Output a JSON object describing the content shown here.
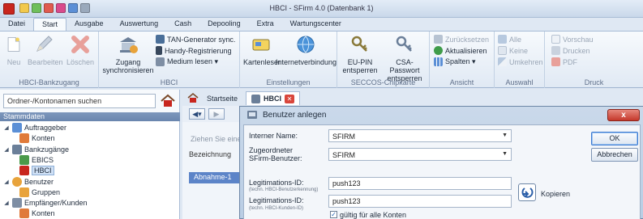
{
  "window": {
    "title": "HBCI - SFirm 4.0 (Datenbank 1)"
  },
  "colors": {
    "accent_blue": "#5c84c8",
    "close_red": "#c5382b",
    "brand_red": "#c8261e"
  },
  "menu_tabs": [
    {
      "label": "Datei"
    },
    {
      "label": "Start"
    },
    {
      "label": "Ausgabe"
    },
    {
      "label": "Auswertung"
    },
    {
      "label": "Cash"
    },
    {
      "label": "Depooling"
    },
    {
      "label": "Extra"
    },
    {
      "label": "Wartungscenter"
    }
  ],
  "ribbon": {
    "hbci_bankzugang": {
      "label": "HBCI-Bankzugang",
      "neu": "Neu",
      "bearbeiten": "Bearbeiten",
      "loeschen": "Löschen"
    },
    "hbci": {
      "label": "HBCI",
      "zugang_line1": "Zugang",
      "zugang_line2": "synchronisieren",
      "tan_generator": "TAN-Generator sync.",
      "handy_registrierung": "Handy-Registrierung",
      "medium_lesen": "Medium lesen ▾"
    },
    "einstellungen": {
      "label": "Einstellungen",
      "kartenleser": "Kartenleser",
      "internetverbindung": "Internetverbindung"
    },
    "seccos": {
      "label": "SECCOS-Chipkarte",
      "eu_pin_line1": "EU-PIN",
      "eu_pin_line2": "entsperren",
      "csa_line1": "CSA-Passwort",
      "csa_line2": "entsperren"
    },
    "ansicht": {
      "label": "Ansicht",
      "zuruecksetzen": "Zurücksetzen",
      "aktualisieren": "Aktualisieren",
      "spalten": "Spalten ▾"
    },
    "auswahl": {
      "label": "Auswahl",
      "alle": "Alle",
      "keine": "Keine",
      "umkehren": "Umkehren"
    },
    "druck": {
      "label": "Druck",
      "vorschau": "Vorschau",
      "drucken": "Drucken",
      "pdf": "PDF"
    }
  },
  "sidebar": {
    "search_placeholder": "Ordner-/Kontonamen suchen",
    "header": "Stammdaten",
    "tree": [
      {
        "label": "Auftraggeber",
        "level": 0
      },
      {
        "label": "Konten",
        "level": 1
      },
      {
        "label": "Bankzugänge",
        "level": 0
      },
      {
        "label": "EBICS",
        "level": 1
      },
      {
        "label": "HBCI",
        "level": 1
      },
      {
        "label": "Benutzer",
        "level": 0
      },
      {
        "label": "Gruppen",
        "level": 1
      },
      {
        "label": "Empfänger/Kunden",
        "level": 0
      },
      {
        "label": "Konten",
        "level": 1
      }
    ]
  },
  "content_tabs": {
    "start": "Startseite",
    "hbci": "HBCI"
  },
  "background": {
    "hint": "Ziehen Sie eine",
    "column": "Bezeichnung",
    "row": "Abnahme-1"
  },
  "dialog": {
    "title": "Benutzer anlegen",
    "interner_name_label": "Interner Name:",
    "interner_name_value": "SFIRM",
    "zugeordneter_label_line1": "Zugeordneter",
    "zugeordneter_label_line2": "SFirm-Benutzer:",
    "zugeordneter_value": "SFIRM",
    "legitimation1_label": "Legitimations-ID:",
    "legitimation1_sub": "(techn. HBCI-Benutzerkennung)",
    "legitimation1_value": "push123",
    "legitimation2_label": "Legitimations-ID:",
    "legitimation2_sub": "(techn. HBCI-Kunden-ID)",
    "legitimation2_value": "push123",
    "kopieren": "Kopieren",
    "checkbox_label": "gültig für alle Konten",
    "checkbox_checked": true,
    "ok": "OK",
    "abbrechen": "Abbrechen",
    "close": "x"
  }
}
